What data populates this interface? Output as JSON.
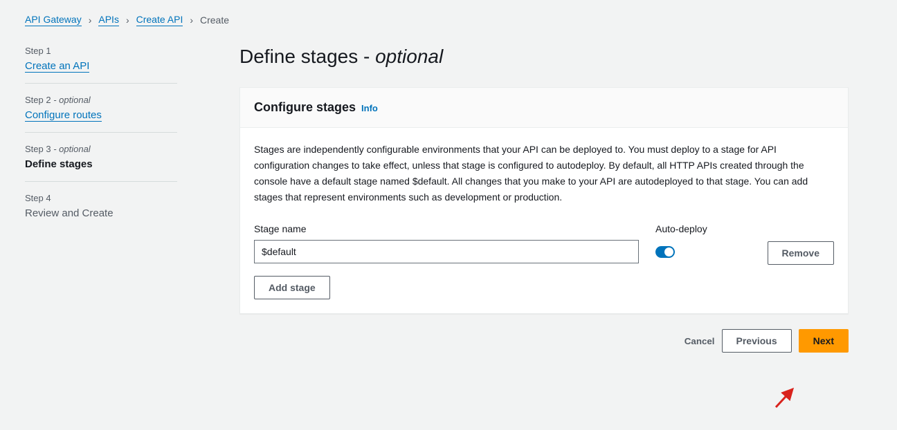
{
  "breadcrumb": {
    "items": [
      {
        "label": "API Gateway"
      },
      {
        "label": "APIs"
      },
      {
        "label": "Create API"
      },
      {
        "label": "Create"
      }
    ]
  },
  "sidebar": {
    "steps": [
      {
        "label": "Step 1",
        "title": "Create an API",
        "type": "link"
      },
      {
        "label": "Step 2",
        "optional": "- optional",
        "title": "Configure routes",
        "type": "link"
      },
      {
        "label": "Step 3",
        "optional": "- optional",
        "title": "Define stages",
        "type": "current"
      },
      {
        "label": "Step 4",
        "title": "Review and Create",
        "type": "upcoming"
      }
    ]
  },
  "page": {
    "title_main": "Define stages ",
    "title_sep": "- ",
    "title_optional": "optional"
  },
  "panel": {
    "title": "Configure stages",
    "info": "Info",
    "description": "Stages are independently configurable environments that your API can be deployed to. You must deploy to a stage for API configuration changes to take effect, unless that stage is configured to autodeploy. By default, all HTTP APIs created through the console have a default stage named $default. All changes that you make to your API are autodeployed to that stage. You can add stages that represent environments such as development or production.",
    "stage_name_label": "Stage name",
    "auto_deploy_label": "Auto-deploy",
    "stage_name_value": "$default",
    "remove_label": "Remove",
    "add_stage_label": "Add stage"
  },
  "actions": {
    "cancel": "Cancel",
    "previous": "Previous",
    "next": "Next"
  }
}
